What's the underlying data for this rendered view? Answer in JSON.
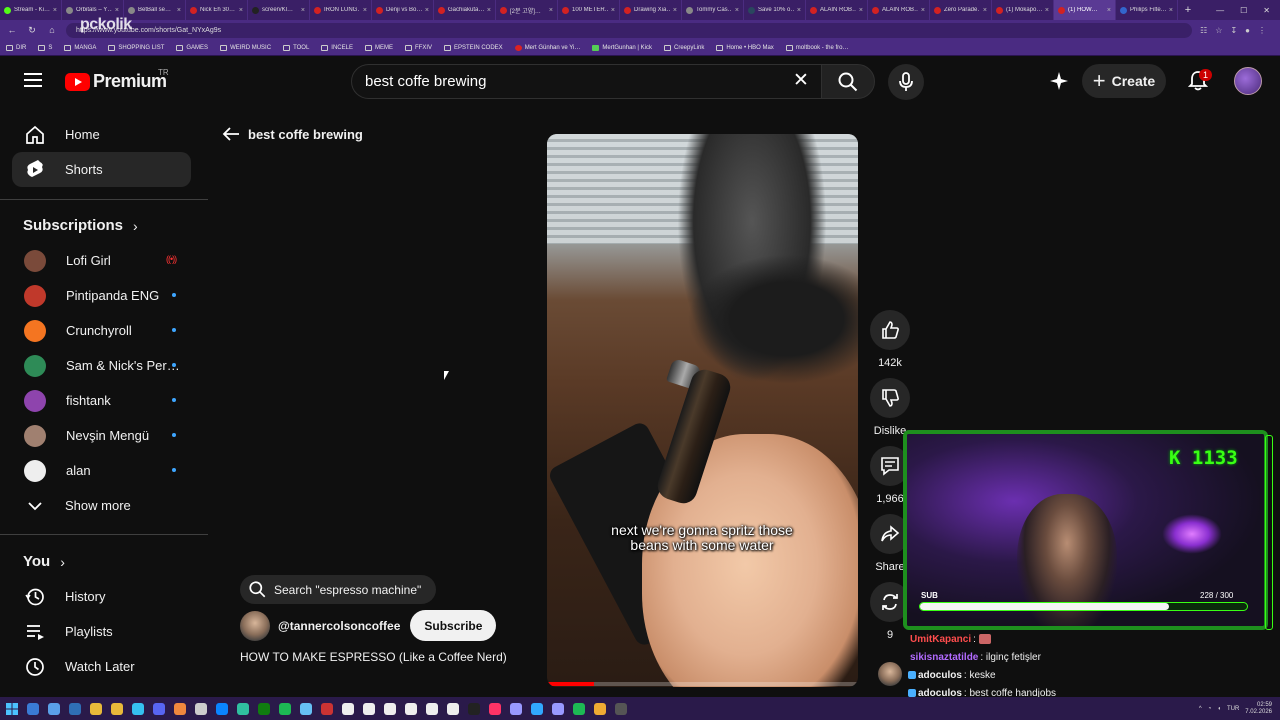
{
  "browser": {
    "tabs": [
      {
        "title": "Stream - Ki…",
        "color": "#53fc18"
      },
      {
        "title": "Orbitals – Y…",
        "color": "#888888"
      },
      {
        "title": "BetBall se…",
        "color": "#888888"
      },
      {
        "title": "Nick Eh 30…",
        "color": "#d22222"
      },
      {
        "title": "screen/Kl…",
        "color": "#222222"
      },
      {
        "title": "IRON LUNG…",
        "color": "#d22222"
      },
      {
        "title": "Denji vs Bo…",
        "color": "#d22222"
      },
      {
        "title": "Gachiakuta…",
        "color": "#d22222"
      },
      {
        "title": "[2분 고양]…",
        "color": "#d22222"
      },
      {
        "title": "100 METER…",
        "color": "#d22222"
      },
      {
        "title": "Drawing Xia…",
        "color": "#d22222"
      },
      {
        "title": "Tommy Cas…",
        "color": "#888888"
      },
      {
        "title": "Save 10% o…",
        "color": "#2a475e"
      },
      {
        "title": "ALAIN ROB…",
        "color": "#d22222"
      },
      {
        "title": "ALAIN ROB…",
        "color": "#d22222"
      },
      {
        "title": "Zero Parade…",
        "color": "#d22222"
      },
      {
        "title": "(1) Mokapo…",
        "color": "#d22222"
      },
      {
        "title": "(1) HOW…",
        "color": "#d22222",
        "active": true
      },
      {
        "title": "Philips Filte…",
        "color": "#3366cc"
      }
    ],
    "url": "https://www.youtube.com/shorts/Gat_NYxAg9s",
    "url_overlay": "pckolik",
    "bookmarks": [
      "DIR",
      "S",
      "MANGA",
      "SHOPPING LIST",
      "GAMES",
      "WEIRD MUSIC",
      "TOOL",
      "INCELE",
      "MEME",
      "FFXIV",
      "EPSTEIN CODEX",
      "Mert Günhan ve Yi…",
      "MertGunhan | Kick",
      "CreepyLink",
      "Home • HBO Max",
      "moltbook - the fro…"
    ]
  },
  "header": {
    "logo_text": "Premium",
    "country": "TR",
    "search_value": "best coffe brewing",
    "create_label": "Create",
    "notification_count": "1"
  },
  "sidebar": {
    "main": [
      {
        "label": "Home",
        "icon": "home-icon"
      },
      {
        "label": "Shorts",
        "icon": "shorts-icon",
        "active": true
      }
    ],
    "subscriptions_title": "Subscriptions",
    "subscriptions": [
      {
        "label": "Lofi Girl",
        "status": "live",
        "color": "#7a4a3a"
      },
      {
        "label": "Pintipanda ENG",
        "status": "new",
        "color": "#c0392b"
      },
      {
        "label": "Crunchyroll",
        "status": "new",
        "color": "#f47521"
      },
      {
        "label": "Sam & Nick's Per…",
        "status": "new",
        "color": "#2e8b57"
      },
      {
        "label": "fishtank",
        "status": "new",
        "color": "#8e44ad"
      },
      {
        "label": "Nevşin Mengü",
        "status": "new",
        "color": "#a08070"
      },
      {
        "label": "alan",
        "status": "new",
        "color": "#eeeeee"
      }
    ],
    "show_more": "Show more",
    "you_title": "You",
    "you_items": [
      {
        "label": "History",
        "icon": "history-icon"
      },
      {
        "label": "Playlists",
        "icon": "playlists-icon"
      },
      {
        "label": "Watch Later",
        "icon": "watch-later-icon"
      }
    ]
  },
  "main": {
    "back_label": "best coffe brewing",
    "caption": "next we're gonna spritz those beans with some water",
    "progress_fraction": 0.15,
    "actions": [
      {
        "name": "like",
        "label": "142k"
      },
      {
        "name": "dislike",
        "label": "Dislike"
      },
      {
        "name": "comments",
        "label": "1,966"
      },
      {
        "name": "share",
        "label": "Share"
      },
      {
        "name": "remix",
        "label": "9"
      }
    ],
    "search_suggestion": "Search \"espresso machine\"",
    "channel": "@tannercolsoncoffee",
    "subscribe_label": "Subscribe",
    "title": "HOW TO MAKE ESPRESSO (Like a Coffee Nerd)"
  },
  "stream_overlay": {
    "kick_count": "K 1133",
    "sub_label": "SUB",
    "sub_count": "228 / 300",
    "sub_progress": 0.76
  },
  "chat": [
    {
      "user": "UmitKapanci",
      "user_color": "#ff4d4d",
      "text": ":",
      "emote": true
    },
    {
      "user": "sikisnaztatilde",
      "user_color": "#b36bff",
      "text": ": ilginç fetişler"
    },
    {
      "user": "adoculos",
      "user_color": "#f1f1f1",
      "text": ": keske",
      "badge": true
    },
    {
      "user": "adoculos",
      "user_color": "#f1f1f1",
      "text": ": best coffe handjobs",
      "badge": true
    }
  ],
  "taskbar": {
    "lang": "TUR",
    "time": "02:59",
    "date": "7.02.2026",
    "icons": [
      "#3a7bd5",
      "#5aa0e8",
      "#2f6fb5",
      "#e8b93a",
      "#e8b93a",
      "#35c0f0",
      "#5865f2",
      "#f0883e",
      "#cccccc",
      "#0a84ff",
      "#30c0a0",
      "#107c10",
      "#1db954",
      "#66c0f4",
      "#cc3333",
      "#eeeeee",
      "#eeeeee",
      "#eeeeee",
      "#eeeeee",
      "#eeeeee",
      "#eeeeee",
      "#222222",
      "#ff3366",
      "#9999ff",
      "#31a8ff",
      "#9999ff",
      "#1db954",
      "#eeaa33",
      "#555555"
    ]
  }
}
